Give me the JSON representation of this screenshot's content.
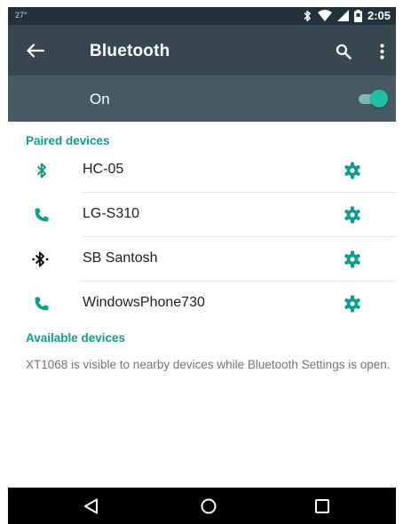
{
  "status_bar": {
    "left_text": "27°",
    "time": "2:05"
  },
  "app_bar": {
    "title": "Bluetooth"
  },
  "master_switch": {
    "label": "On",
    "enabled": true,
    "accent_color": "#22bfa6"
  },
  "paired_section": {
    "header": "Paired devices"
  },
  "paired_devices": [
    {
      "name": "HC-05",
      "icon": "bluetooth-icon"
    },
    {
      "name": "LG-S310",
      "icon": "phone-icon"
    },
    {
      "name": "SB Santosh",
      "icon": "bluetooth-connected-icon"
    },
    {
      "name": "WindowsPhone730",
      "icon": "phone-icon"
    }
  ],
  "available_section": {
    "header": "Available devices",
    "description": "XT1068 is visible to nearby devices while Bluetooth Settings is open."
  },
  "colors": {
    "app_bar": "#37474f",
    "switch_row": "#475a63",
    "accent": "#109e8c"
  }
}
